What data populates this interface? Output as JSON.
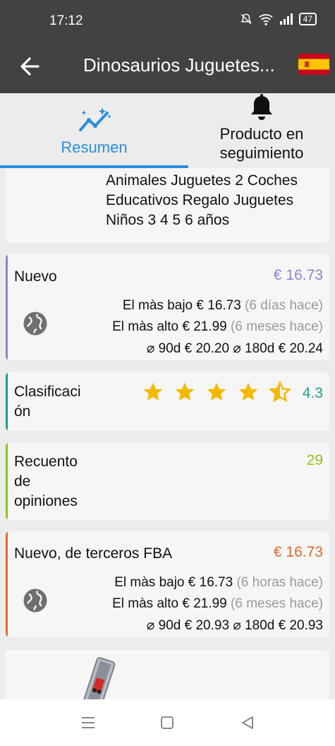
{
  "status_bar": {
    "time": "17:12",
    "battery": "47"
  },
  "app_bar": {
    "title": "Dinosaurios Juguetes...",
    "flag_icon": "spain-flag-icon"
  },
  "tabs": [
    {
      "label": "Resumen",
      "icon": "trend-chart-icon",
      "active": true
    },
    {
      "label": "Producto en seguimiento",
      "icon": "bell-icon",
      "active": false
    }
  ],
  "product_title": "Animales Juguetes 2 Coches Educativos Regalo Juguetes Niños 3 4 5 6 años",
  "new": {
    "label": "Nuevo",
    "price": "€ 16.73",
    "accent": "#8b84d4",
    "lowest_label": "El màs bajo",
    "lowest_price": "€ 16.73",
    "lowest_when": "(6 días hace)",
    "highest_label": "El màs alto",
    "highest_price": "€ 21.99",
    "highest_when": "(6 meses hace)",
    "avg90_label": "⌀ 90d",
    "avg90_price": "€ 20.20",
    "avg180_label": "⌀ 180d",
    "avg180_price": "€ 20.24"
  },
  "rating": {
    "label": "Clasificación",
    "label_line1": "Clasificaci",
    "label_line2": "ón",
    "value": "4.3",
    "stars": 4.3,
    "accent": "#1e9e8e",
    "star_color": "#f5b800"
  },
  "reviews": {
    "label_line1": "Recuento",
    "label_line2": "de",
    "label_line3": "opiniones",
    "value": "29",
    "accent": "#8cc21d"
  },
  "fba": {
    "label": "Nuevo, de terceros FBA",
    "price": "€ 16.73",
    "accent": "#e06a2c",
    "lowest_label": "El màs bajo",
    "lowest_price": "€ 16.73",
    "lowest_when": "(6 horas hace)",
    "highest_label": "El màs alto",
    "highest_price": "€ 21.99",
    "highest_when": "(6 meses hace)",
    "avg90_label": "⌀ 90d",
    "avg90_price": "€ 20.93",
    "avg180_label": "⌀ 180d",
    "avg180_price": "€ 20.93"
  },
  "nav_bar": {
    "buttons": [
      "menu-icon",
      "home-square-icon",
      "back-triangle-icon"
    ]
  }
}
